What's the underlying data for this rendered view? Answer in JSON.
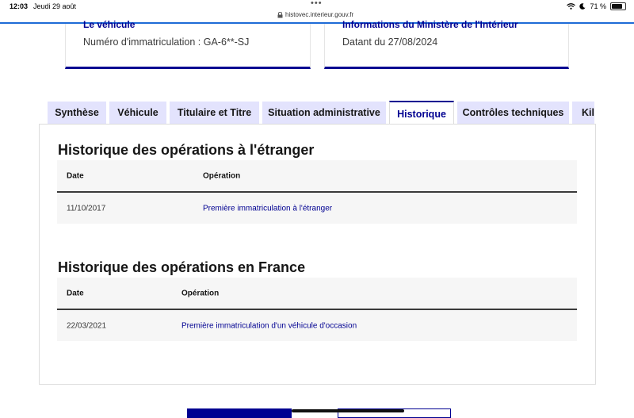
{
  "status_bar": {
    "time": "12:03",
    "date": "Jeudi 29 août",
    "url": "histovec.interieur.gouv.fr",
    "battery": "71 %"
  },
  "cards": [
    {
      "title": "Le véhicule",
      "subtitle": "Numéro d'immatriculation : GA-6**-SJ"
    },
    {
      "title": "Informations du Ministère de l'Intérieur",
      "subtitle": "Datant du 27/08/2024"
    }
  ],
  "tabs": [
    {
      "label": "Synthèse"
    },
    {
      "label": "Véhicule"
    },
    {
      "label": "Titulaire et Titre"
    },
    {
      "label": "Situation administrative"
    },
    {
      "label": "Historique"
    },
    {
      "label": "Contrôles techniques"
    },
    {
      "label": "Kilo"
    }
  ],
  "active_tab": "Historique",
  "foreign": {
    "title": "Historique des opérations à l'étranger",
    "headers": {
      "date": "Date",
      "operation": "Opération"
    },
    "rows": [
      {
        "date": "11/10/2017",
        "operation": "Première immatriculation à l'étranger"
      }
    ]
  },
  "france": {
    "title": "Historique des opérations en France",
    "headers": {
      "date": "Date",
      "operation": "Opération"
    },
    "rows": [
      {
        "date": "22/03/2021",
        "operation": "Première immatriculation d'un véhicule d'occasion"
      }
    ]
  },
  "colors": {
    "accent": "#000091",
    "tab_bg": "#e3e3fd",
    "table_bg": "#f6f6f6"
  }
}
